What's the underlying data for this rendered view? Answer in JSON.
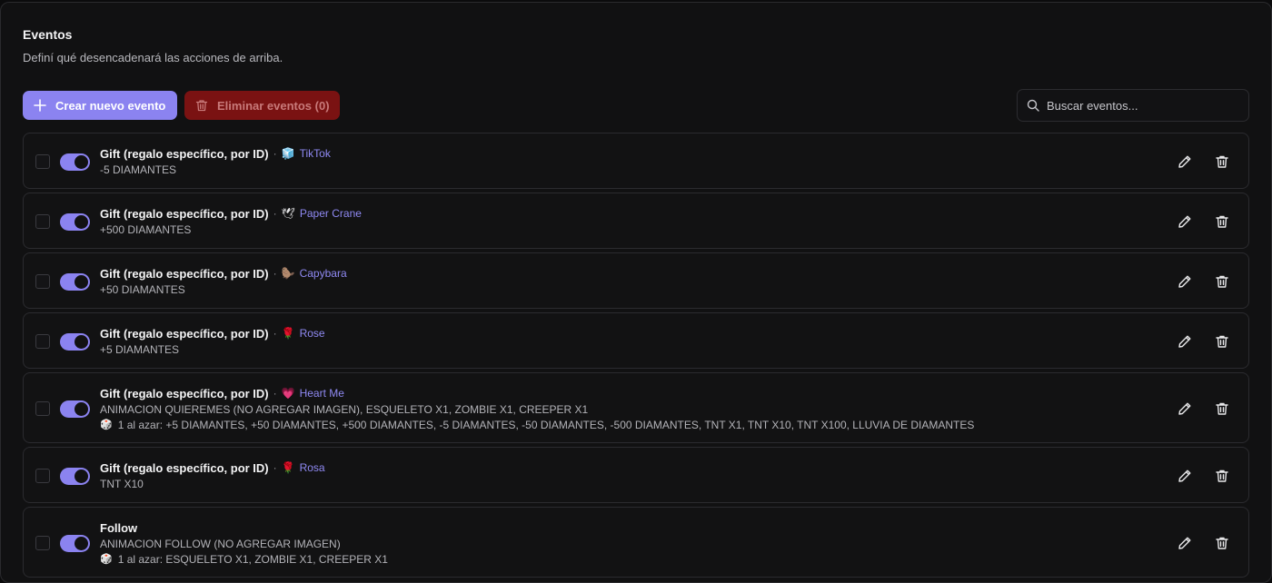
{
  "header": {
    "title": "Eventos",
    "subtitle": "Definí qué desencadenará las acciones de arriba."
  },
  "toolbar": {
    "create_label": "Crear nuevo evento",
    "delete_label": "Eliminar eventos (0)",
    "search_placeholder": "Buscar eventos..."
  },
  "colors": {
    "accent": "#8b83f0",
    "danger": "#7a1212",
    "gift_link": "#8f89f2"
  },
  "events": [
    {
      "title": "Gift (regalo específico, por ID)",
      "separator": "·",
      "gift_emoji": "🧊",
      "gift_icon": "tiktok-gift-icon",
      "gift_name": "TikTok",
      "desc": "-5 DIAMANTES",
      "random": null,
      "enabled": true
    },
    {
      "title": "Gift (regalo específico, por ID)",
      "separator": "·",
      "gift_emoji": "🕊",
      "gift_icon": "paper-crane-icon",
      "gift_name": "Paper Crane",
      "desc": "+500 DIAMANTES",
      "random": null,
      "enabled": true
    },
    {
      "title": "Gift (regalo específico, por ID)",
      "separator": "·",
      "gift_emoji": "🦫",
      "gift_icon": "capybara-icon",
      "gift_name": "Capybara",
      "desc": "+50 DIAMANTES",
      "random": null,
      "enabled": true
    },
    {
      "title": "Gift (regalo específico, por ID)",
      "separator": "·",
      "gift_emoji": "🌹",
      "gift_icon": "rose-icon",
      "gift_name": "Rose",
      "desc": "+5 DIAMANTES",
      "random": null,
      "enabled": true
    },
    {
      "title": "Gift (regalo específico, por ID)",
      "separator": "·",
      "gift_emoji": "💗",
      "gift_icon": "heart-me-icon",
      "gift_name": "Heart Me",
      "desc": "ANIMACION QUIEREMES (NO AGREGAR IMAGEN), ESQUELETO X1, ZOMBIE X1, CREEPER X1",
      "random": "1 al azar: +5 DIAMANTES, +50 DIAMANTES, +500 DIAMANTES, -5 DIAMANTES, -50 DIAMANTES, -500 DIAMANTES, TNT X1, TNT X10, TNT X100, LLUVIA DE DIAMANTES",
      "enabled": true
    },
    {
      "title": "Gift (regalo específico, por ID)",
      "separator": "·",
      "gift_emoji": "🌹",
      "gift_icon": "rosa-icon",
      "gift_name": "Rosa",
      "desc": "TNT X10",
      "random": null,
      "enabled": true
    },
    {
      "title": "Follow",
      "separator": "",
      "gift_emoji": "",
      "gift_icon": "",
      "gift_name": "",
      "desc": "ANIMACION FOLLOW (NO AGREGAR IMAGEN)",
      "random": "1 al azar: ESQUELETO X1, ZOMBIE X1, CREEPER X1",
      "enabled": true
    }
  ],
  "random_icon": "dice-icon",
  "random_glyph": "🎲"
}
